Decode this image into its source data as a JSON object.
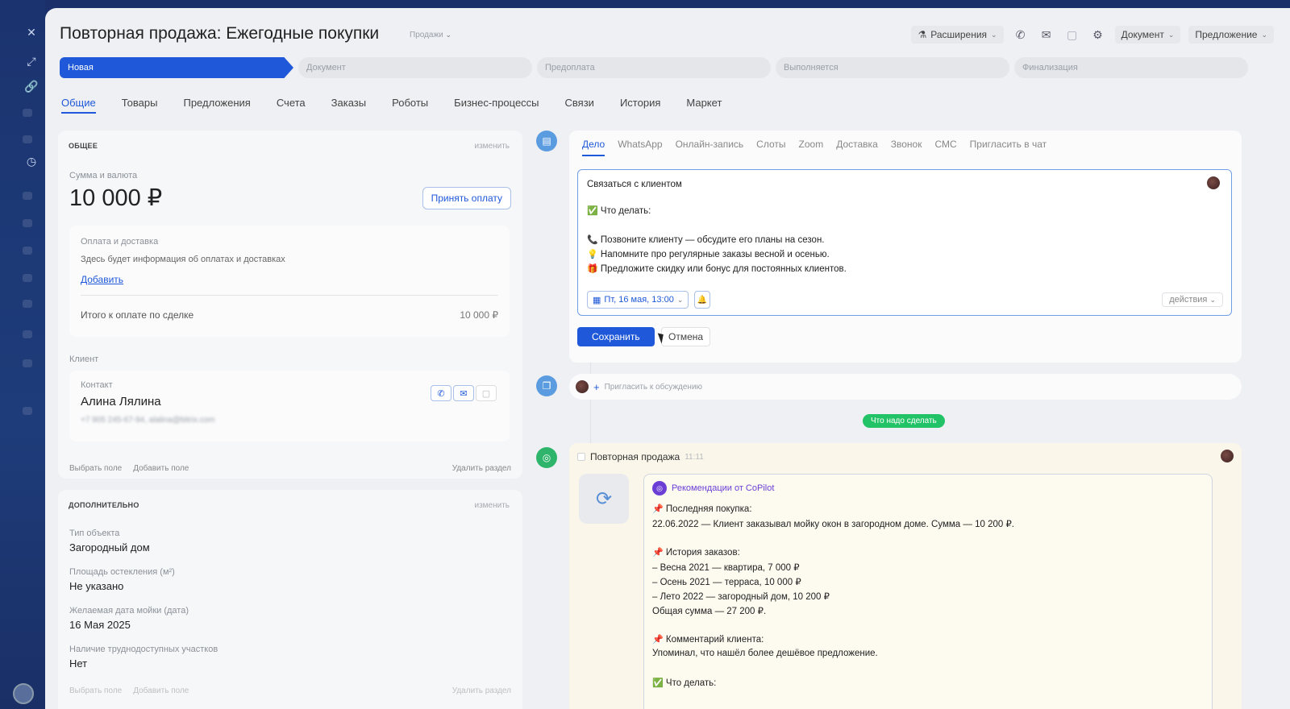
{
  "page": {
    "title": "Повторная продажа: Ежегодные покупки",
    "category": "Продажи"
  },
  "top_actions": {
    "extensions": "Расширения",
    "document": "Документ",
    "proposal": "Предложение"
  },
  "stages": [
    "Новая",
    "Документ",
    "Предоплата",
    "Выполняется",
    "Финализация"
  ],
  "tabs": [
    "Общие",
    "Товары",
    "Предложения",
    "Счета",
    "Заказы",
    "Роботы",
    "Бизнес-процессы",
    "Связи",
    "История",
    "Маркет"
  ],
  "general": {
    "heading": "ОБЩЕЕ",
    "edit": "изменить",
    "amount_label": "Сумма и валюта",
    "amount": "10 000 ₽",
    "accept_payment": "Принять оплату",
    "payment_title": "Оплата и доставка",
    "payment_info": "Здесь будет информация об оплатах и доставках",
    "add": "Добавить",
    "total_label": "Итого к оплате по сделке",
    "total_value": "10 000 ₽",
    "client_label": "Клиент",
    "contact_label": "Контакт",
    "contact_name": "Алина Лялина",
    "contact_details": "+7 905 245-67-94, alalina@bitrix.com",
    "select_field": "Выбрать поле",
    "add_field": "Добавить поле",
    "delete_section": "Удалить раздел"
  },
  "additional": {
    "heading": "ДОПОЛНИТЕЛЬНО",
    "edit": "изменить",
    "fields": [
      {
        "label": "Тип объекта",
        "value": "Загородный дом"
      },
      {
        "label": "Площадь остекления (м²)",
        "value": "Не указано"
      },
      {
        "label": "Желаемая дата мойки (дата)",
        "value": "16 Мая 2025"
      },
      {
        "label": "Наличие труднодоступных участков",
        "value": "Нет"
      }
    ],
    "footer_select": "Выбрать поле",
    "footer_add": "Добавить поле",
    "footer_delete": "Удалить раздел"
  },
  "editor": {
    "tabs": [
      "Дело",
      "WhatsApp",
      "Онлайн-запись",
      "Слоты",
      "Zoom",
      "Доставка",
      "Звонок",
      "СМС",
      "Пригласить в чат"
    ],
    "lines": [
      "Связаться с клиентом",
      "Что делать:",
      "Позвоните клиенту — обсудите его планы на сезон.",
      "Напомните про регулярные заказы весной и осенью.",
      "Предложите скидку или бонус для постоянных клиентов."
    ],
    "date": "Пт, 16 мая, 13:00",
    "actions": "действия",
    "save": "Сохранить",
    "cancel": "Отмена"
  },
  "comment": {
    "placeholder": "Пригласить к обсуждению"
  },
  "todo_pill": "Что надо сделать",
  "activity": {
    "title": "Повторная продажа",
    "time": "11:11",
    "copilot_title": "Рекомендации от CoPilot",
    "lines": [
      "Последняя покупка:",
      "22.06.2022 — Клиент заказывал мойку окон в загородном доме. Сумма — 10 200 ₽.",
      "История заказов:",
      "– Весна 2021 — квартира, 7 000 ₽",
      "– Осень 2021 — терраса, 10 000 ₽",
      "– Лето 2022 — загородный дом, 10 200 ₽",
      "Общая сумма — 27 200 ₽.",
      "Комментарий клиента:",
      "Упоминал, что нашёл более дешёвое предложение.",
      "Что делать:"
    ]
  },
  "colors": {
    "accent": "#1f58d8",
    "green": "#22c266",
    "copilot": "#6b3fd6"
  }
}
